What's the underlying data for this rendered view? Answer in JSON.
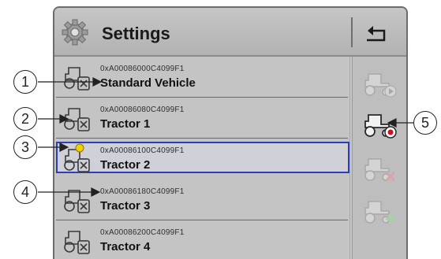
{
  "header": {
    "title": "Settings"
  },
  "vehicles": [
    {
      "id": "0xA00086000C4099F1",
      "name": "Standard Vehicle",
      "selected": false
    },
    {
      "id": "0xA00086080C4099F1",
      "name": "Tractor  1",
      "selected": false
    },
    {
      "id": "0xA00086100C4099F1",
      "name": "Tractor  2",
      "selected": true
    },
    {
      "id": "0xA00086180C4099F1",
      "name": "Tractor  3",
      "selected": false
    },
    {
      "id": "0xA00086200C4099F1",
      "name": "Tractor  4",
      "selected": false
    }
  ],
  "side_buttons": [
    {
      "icon": "tractor-play-icon",
      "enabled": false
    },
    {
      "icon": "tractor-record-icon",
      "enabled": true
    },
    {
      "icon": "tractor-delete-icon",
      "enabled": false
    },
    {
      "icon": "tractor-add-icon",
      "enabled": false
    }
  ],
  "callouts": [
    "1",
    "2",
    "3",
    "4",
    "5"
  ],
  "colors": {
    "selection_border": "#2c3fb8",
    "record_dot": "#d0101a",
    "active_dot": "#f2d000"
  }
}
